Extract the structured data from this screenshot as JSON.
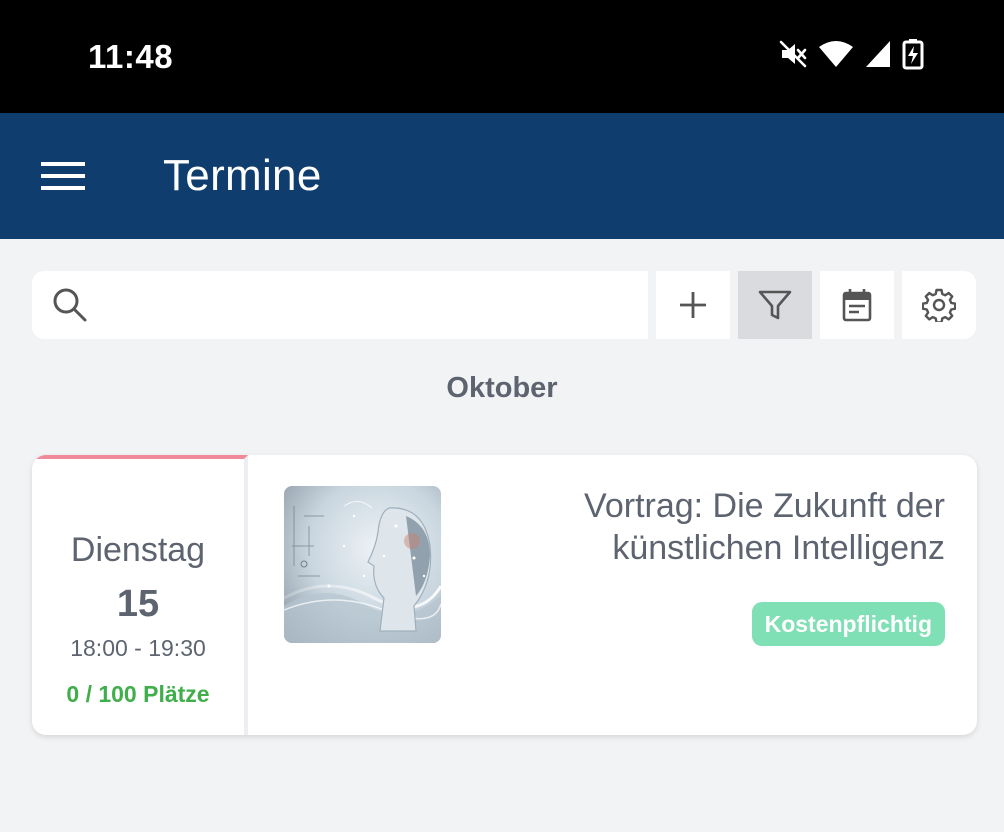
{
  "status_bar": {
    "time": "11:48",
    "icons": [
      "mute-icon",
      "wifi-icon",
      "signal-icon",
      "battery-charging-icon"
    ]
  },
  "app_bar": {
    "title": "Termine",
    "background": "#0f3d6e"
  },
  "toolbar": {
    "search_placeholder": "",
    "buttons": [
      "add-icon",
      "filter-icon",
      "calendar-icon",
      "settings-icon"
    ],
    "active_button": "filter-icon"
  },
  "month": "Oktober",
  "events": [
    {
      "weekday": "Dienstag",
      "day": "15",
      "time": "18:00 - 19:30",
      "seats": "0 / 100 Plätze",
      "title_line1": "Vortrag: Die Zukunft der",
      "title_line2": "künstlichen Intelligenz",
      "tag": "Kostenpflichtig",
      "accent_color": "#f08a9a",
      "tag_color": "#7fdfb5",
      "seats_color": "#3fae4b"
    }
  ]
}
